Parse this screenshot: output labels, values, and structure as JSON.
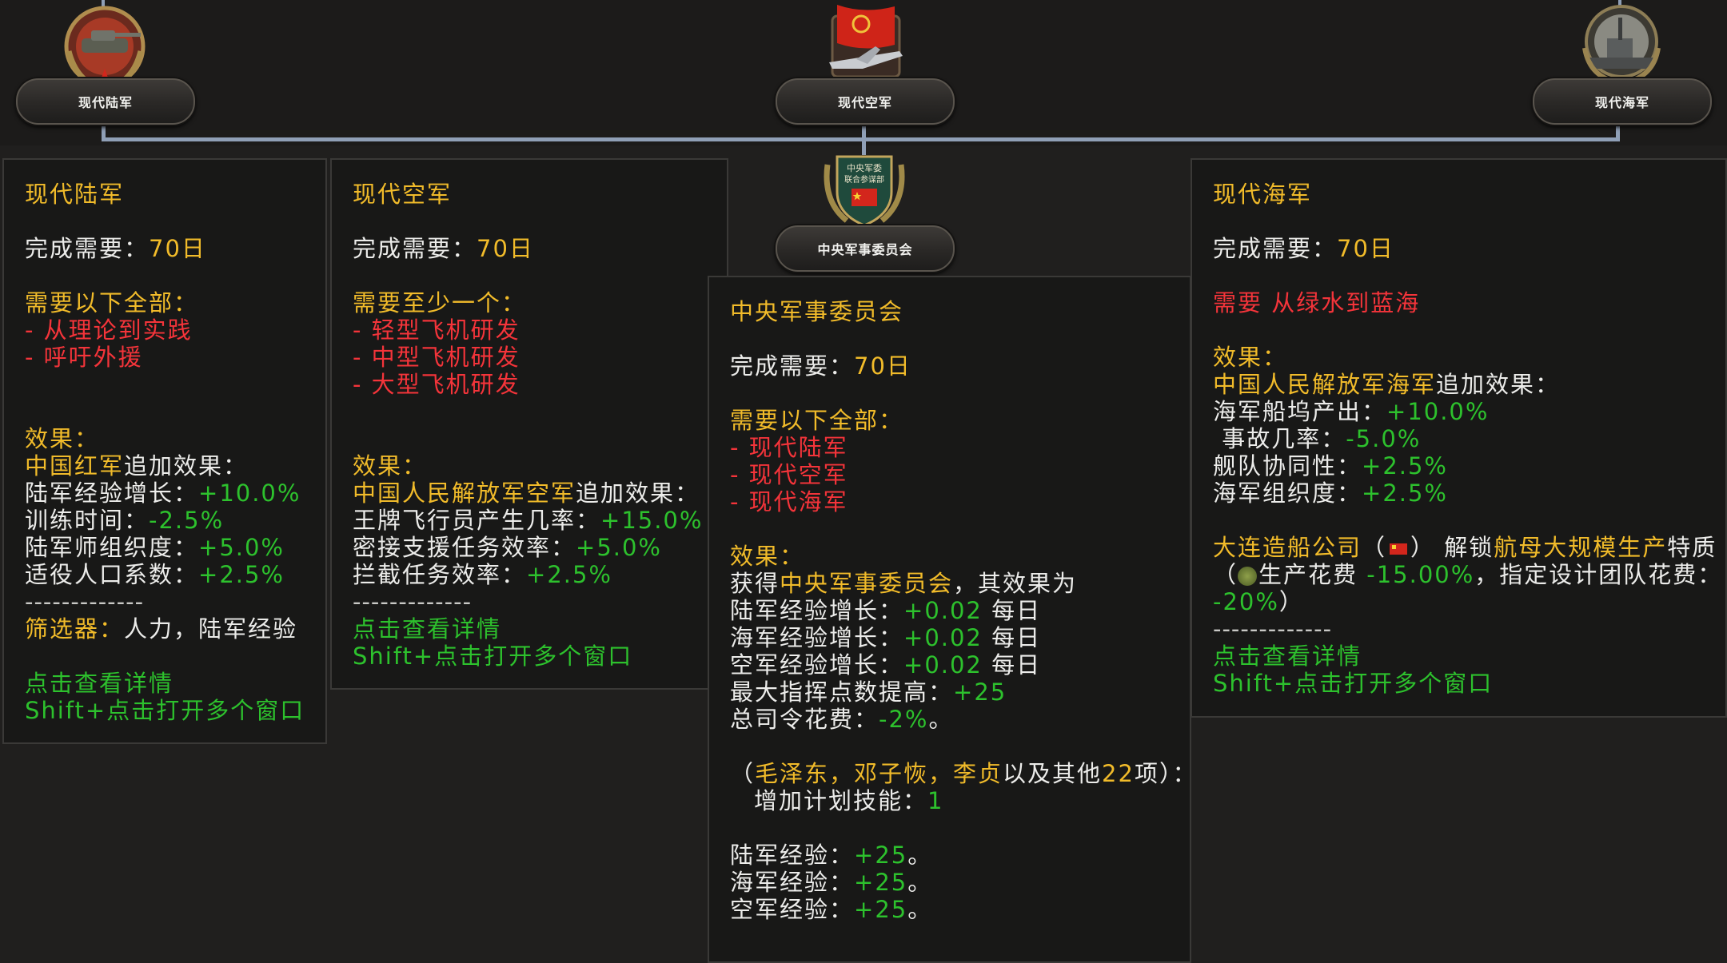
{
  "nodes": {
    "army": {
      "label": "现代陆军"
    },
    "air": {
      "label": "现代空军"
    },
    "navy": {
      "label": "现代海军"
    },
    "cmc": {
      "label": "中央军事委员会"
    }
  },
  "cmc_emblem_text": [
    "中央军委",
    "联合参谋部"
  ],
  "colors": {
    "gold": "#f1bb2a",
    "red": "#f4343a",
    "green": "#2dc12d",
    "white": "#ececea",
    "line": "#8f9fb6"
  },
  "army_tip": {
    "title": "现代陆军",
    "req_label": "完成需要：",
    "req_days": "70日",
    "prereq_header": "需要以下全部：",
    "prereqs": [
      "- 从理论到实践",
      "- 呼吁外援"
    ],
    "effects_header": "效果：",
    "bonus_owner": "中国红军",
    "bonus_suffix": "追加效果：",
    "stats": [
      {
        "label": "陆军经验增长：",
        "value": "+10.0%"
      },
      {
        "label": "训练时间：",
        "value": "-2.5%"
      },
      {
        "label": "陆军师组织度：",
        "value": "+5.0%"
      },
      {
        "label": "适役人口系数：",
        "value": "+2.5%"
      }
    ],
    "divider": "-------------",
    "filter_label": "筛选器：",
    "filter_value": "人力，陆军经验",
    "click_hint": "点击查看详情",
    "shift_hint": "Shift+点击打开多个窗口"
  },
  "air_tip": {
    "title": "现代空军",
    "req_label": "完成需要：",
    "req_days": "70日",
    "prereq_header": "需要至少一个：",
    "prereqs": [
      "- 轻型飞机研发",
      "- 中型飞机研发",
      "- 大型飞机研发"
    ],
    "effects_header": "效果：",
    "bonus_owner": "中国人民解放军空军",
    "bonus_suffix": "追加效果：",
    "stats": [
      {
        "label": "王牌飞行员产生几率：",
        "value": "+15.0%"
      },
      {
        "label": "密接支援任务效率：",
        "value": "+5.0%"
      },
      {
        "label": "拦截任务效率：",
        "value": "+2.5%"
      }
    ],
    "divider": "-------------",
    "click_hint": "点击查看详情",
    "shift_hint": "Shift+点击打开多个窗口"
  },
  "cmc_tip": {
    "title": "中央军事委员会",
    "req_label": "完成需要：",
    "req_days": "70日",
    "prereq_header": "需要以下全部：",
    "prereqs": [
      "- 现代陆军",
      "- 现代空军",
      "- 现代海军"
    ],
    "effects_header": "效果：",
    "gain_prefix": "获得",
    "gain_name": "中央军事委员会",
    "gain_suffix": "，其效果为",
    "stats": [
      {
        "label": "陆军经验增长：",
        "value": "+0.02",
        "unit": " 每日"
      },
      {
        "label": "海军经验增长：",
        "value": "+0.02",
        "unit": " 每日"
      },
      {
        "label": "空军经验增长：",
        "value": "+0.02",
        "unit": " 每日"
      },
      {
        "label": "最大指挥点数提高：",
        "value": "+25",
        "unit": ""
      },
      {
        "label": "总司令花费：",
        "value": "-2%",
        "unit": "。"
      }
    ],
    "leaders_open": "（",
    "leaders_names": "毛泽东，邓子恢，李贞",
    "leaders_mid": "以及其他",
    "leaders_count": "22",
    "leaders_close": "项）：",
    "skill_label": "增加计划技能：",
    "skill_value": "1",
    "exp": [
      {
        "label": "陆军经验：",
        "value": "+25",
        "unit": "。"
      },
      {
        "label": "海军经验：",
        "value": "+25",
        "unit": "。"
      },
      {
        "label": "空军经验：",
        "value": "+25",
        "unit": "。"
      }
    ]
  },
  "navy_tip": {
    "title": "现代海军",
    "req_label": "完成需要：",
    "req_days": "70日",
    "needs": "需要 从绿水到蓝海",
    "effects_header": "效果：",
    "bonus_owner": "中国人民解放军海军",
    "bonus_suffix": "追加效果：",
    "stats": [
      {
        "label": "海军船坞产出：",
        "value": "+10.0%"
      },
      {
        "label": " 事故几率：",
        "value": "-5.0%"
      },
      {
        "label": "舰队协同性：",
        "value": "+2.5%"
      },
      {
        "label": "海军组织度：",
        "value": "+2.5%"
      }
    ],
    "company": "大连造船公司",
    "company_open": "（",
    "company_close": "）",
    "unlock_prefix": " 解锁",
    "unlock_item": "航母大规模生产",
    "unlock_suffix": "特质",
    "cost_open": "（",
    "cost_label": "生产花费 ",
    "cost_value": "-15.00%",
    "cost_mid": "，指定设计团队花费：",
    "team_value": "-20%",
    "team_close": "）",
    "divider": "-------------",
    "click_hint": "点击查看详情",
    "shift_hint": "Shift+点击打开多个窗口"
  }
}
